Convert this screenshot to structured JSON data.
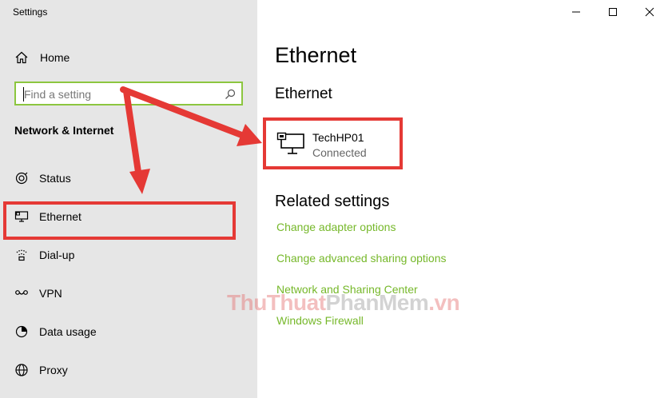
{
  "window": {
    "title": "Settings"
  },
  "sidebar": {
    "home_label": "Home",
    "search": {
      "placeholder": "Find a setting"
    },
    "section_title": "Network & Internet",
    "items": [
      {
        "label": "Status",
        "icon": "status-icon"
      },
      {
        "label": "Ethernet",
        "icon": "ethernet-icon"
      },
      {
        "label": "Dial-up",
        "icon": "dialup-icon"
      },
      {
        "label": "VPN",
        "icon": "vpn-icon"
      },
      {
        "label": "Data usage",
        "icon": "data-usage-icon"
      },
      {
        "label": "Proxy",
        "icon": "globe-icon"
      }
    ]
  },
  "main": {
    "title": "Ethernet",
    "subheading": "Ethernet",
    "adapter": {
      "name": "TechHP01",
      "status": "Connected",
      "icon": "computer-network-icon"
    },
    "related_title": "Related settings",
    "related_links": [
      "Change adapter options",
      "Change advanced sharing options",
      "Network and Sharing Center",
      "Windows Firewall"
    ]
  },
  "watermark": {
    "part1": "ThuThuat",
    "part2": "PhanMem",
    "part3": ".vn"
  },
  "colors": {
    "accent": "#76b82a",
    "annotation": "#e53935",
    "sidebar_bg": "#e6e6e6"
  }
}
